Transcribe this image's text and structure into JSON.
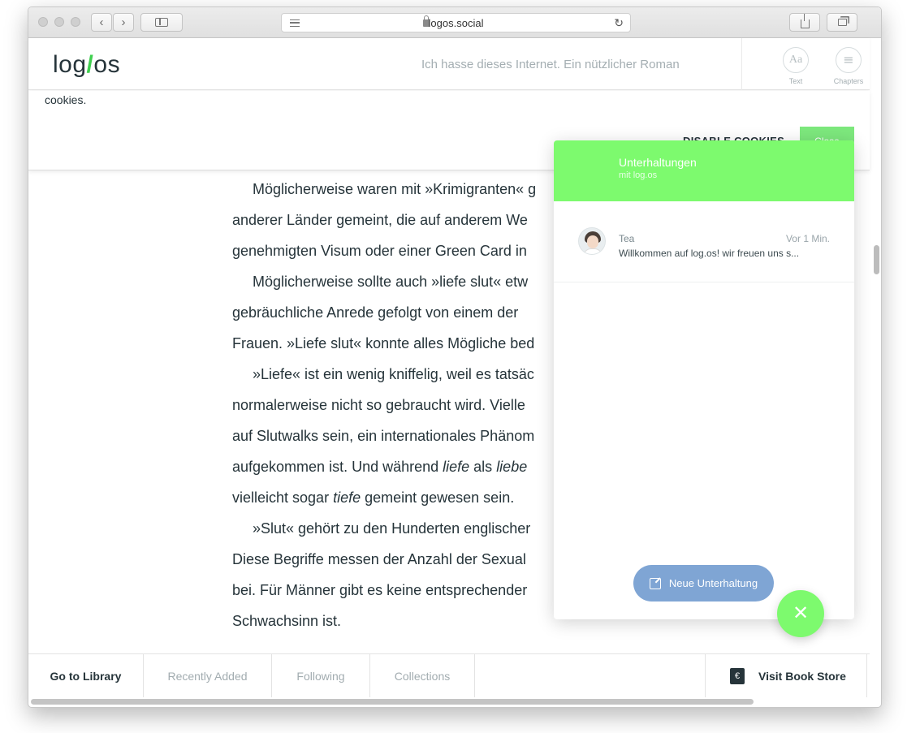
{
  "browser": {
    "url": "logos.social",
    "back_icon": "‹",
    "forward_icon": "›",
    "reload_icon": "↻",
    "plus_icon": "+"
  },
  "header": {
    "logo_pre": "log",
    "logo_slash": "/",
    "logo_post": "os",
    "book_title": "Ich hasse dieses Internet. Ein nützlicher Roman",
    "text_icon": "Aa",
    "text_label": "Text",
    "chapters_icon": "≡",
    "chapters_label": "Chapters"
  },
  "cookie": {
    "text": "cookies.",
    "disable_label": "DISABLE COOKIES",
    "close_label": "Close"
  },
  "reader": {
    "lines": [
      {
        "a": "Möglicherweise waren mit »Krimigranten« g",
        "indent": true
      },
      {
        "a": "anderer Länder gemeint, die auf anderem We"
      },
      {
        "a": "genehmigten Visum oder einer Green Card in"
      },
      {
        "a": "Möglicherweise sollte auch »liefe slut« etw",
        "indent": true
      },
      {
        "a": "gebräuchliche Anrede gefolgt von einem der"
      },
      {
        "a": "Frauen. »Liefe slut« konnte alles Mögliche bed"
      },
      {
        "a": "»Liefe« ist ein wenig kniffelig, weil es tatsäc",
        "indent": true
      },
      {
        "a": "normalerweise nicht so gebraucht wird. Vielle"
      },
      {
        "a": "auf Slutwalks sein, ein internationales Phänom"
      },
      {
        "a": "aufgekommen ist. Und während ",
        "em": "liefe",
        "b": " als ",
        "em2": "liebe"
      },
      {
        "a": "vielleicht sogar ",
        "em": "tiefe",
        "b": " gemeint gewesen sein."
      },
      {
        "a": "»Slut« gehört zu den Hunderten englischer",
        "indent": true
      },
      {
        "a": "Diese Begriffe messen der Anzahl der Sexual"
      },
      {
        "a": "bei. Für Männer gibt es keine entsprechender"
      },
      {
        "a": "Schwachsinn ist."
      }
    ]
  },
  "footer": {
    "go_to_library": "Go to Library",
    "recently_added": "Recently Added",
    "following": "Following",
    "collections": "Collections",
    "store_icon": "€",
    "visit_store": "Visit Book Store"
  },
  "chat": {
    "title": "Unterhaltungen",
    "subtitle": "mit log.os",
    "conversation": {
      "name": "Tea",
      "time": "Vor 1 Min.",
      "message": "Willkommen auf log.os! wir freuen uns s..."
    },
    "new_conversation": "Neue Unterhaltung",
    "fab_icon": "✕"
  },
  "colors": {
    "accent_green": "#7dfa6e",
    "new_button_blue": "#7fa5d4",
    "text_dark": "#26343a"
  }
}
